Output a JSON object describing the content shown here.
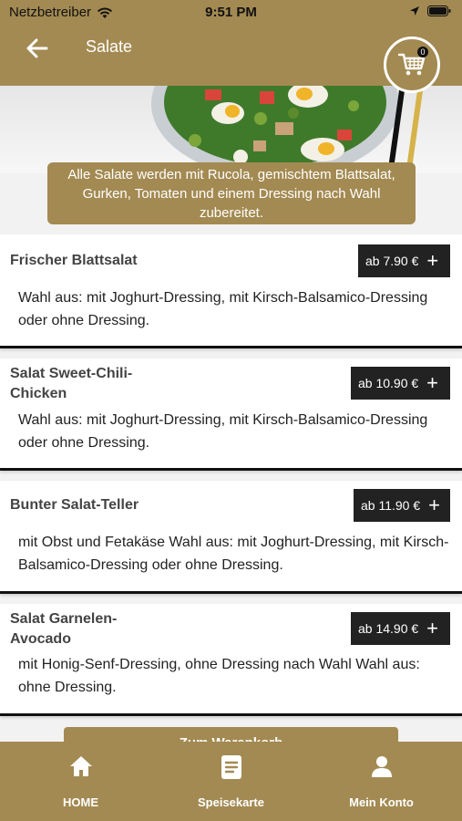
{
  "status_bar": {
    "carrier": "Netzbetreiber",
    "time": "9:51 PM"
  },
  "header": {
    "title": "Salate",
    "cart_count": "0"
  },
  "banner": {
    "text": "Alle Salate werden mit Rucola, gemischtem Blattsalat, Gurken, Tomaten und einem Dressing nach Wahl zubereitet."
  },
  "items": [
    {
      "name": "Frischer Blattsalat",
      "price": "ab 7.90 €",
      "description": "Wahl aus: mit Joghurt-Dressing, mit Kirsch-Balsamico-Dressing oder ohne Dressing."
    },
    {
      "name": "Salat Sweet-Chili-Chicken",
      "price": "ab 10.90 €",
      "description": "Wahl aus: mit Joghurt-Dressing, mit Kirsch-Balsamico-Dressing oder ohne Dressing."
    },
    {
      "name": "Bunter Salat-Teller",
      "price": "ab 11.90 €",
      "description": "mit Obst und Fetakäse Wahl aus: mit Joghurt-Dressing, mit Kirsch-Balsamico-Dressing oder ohne Dressing."
    },
    {
      "name": "Salat Garnelen-Avocado",
      "price": "ab 14.90 €",
      "description": "mit Honig-Senf-Dressing, ohne Dressing nach Wahl Wahl aus: ohne Dressing."
    }
  ],
  "cart_button": {
    "label": "Zum Warenkorb"
  },
  "tabs": [
    {
      "label": "HOME",
      "icon": "home-icon"
    },
    {
      "label": "Speisekarte",
      "icon": "menu-icon"
    },
    {
      "label": "Mein Konto",
      "icon": "person-icon"
    }
  ],
  "colors": {
    "brand": "#a38a52",
    "price_bg": "#222222"
  }
}
